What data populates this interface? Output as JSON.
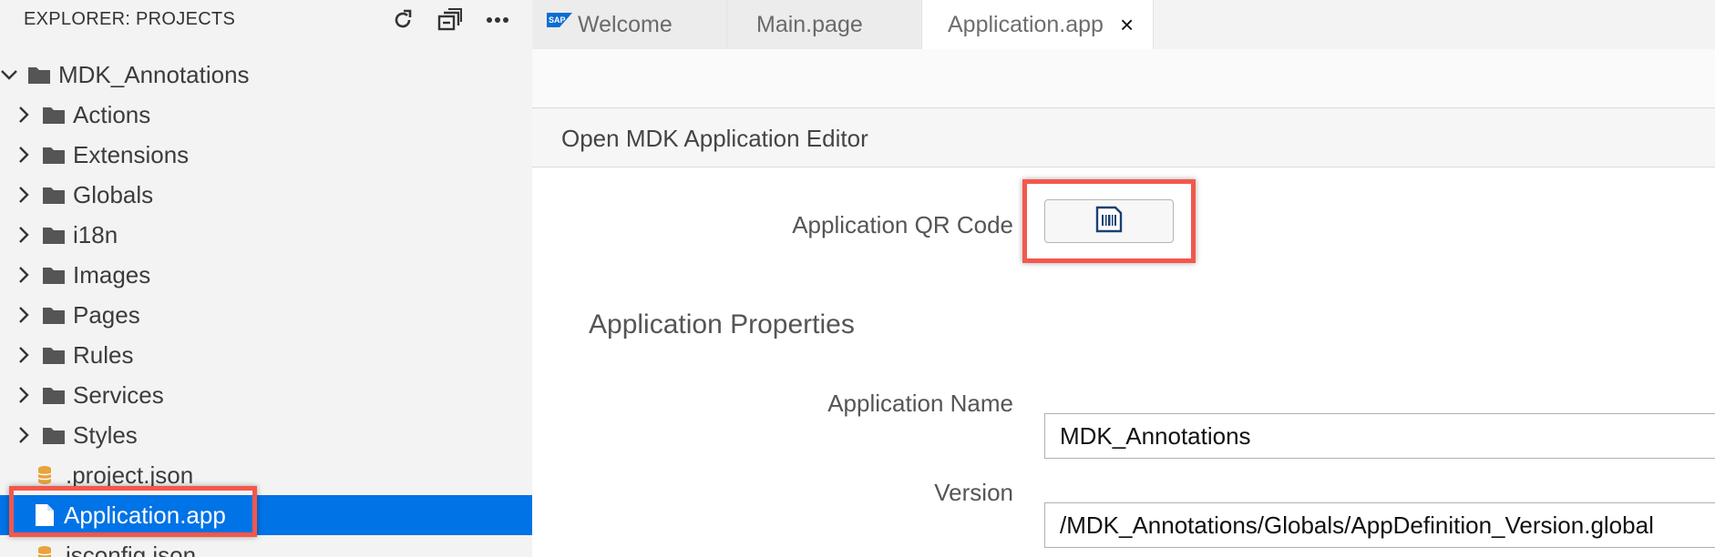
{
  "sidebar": {
    "title": "EXPLORER: PROJECTS",
    "root": {
      "label": "MDK_Annotations",
      "expanded": true
    },
    "folders": [
      {
        "label": "Actions"
      },
      {
        "label": "Extensions"
      },
      {
        "label": "Globals"
      },
      {
        "label": "i18n"
      },
      {
        "label": "Images"
      },
      {
        "label": "Pages"
      },
      {
        "label": "Rules"
      },
      {
        "label": "Services"
      },
      {
        "label": "Styles"
      }
    ],
    "files": [
      {
        "label": ".project.json",
        "icon": "database-icon"
      },
      {
        "label": "Application.app",
        "icon": "file-icon",
        "selected": true
      },
      {
        "label": "jsconfig.json",
        "icon": "database-icon"
      }
    ]
  },
  "tabs": [
    {
      "label": "Welcome",
      "icon": "sap-logo-icon"
    },
    {
      "label": "Main.page"
    },
    {
      "label": "Application.app",
      "active": true,
      "close": "×"
    }
  ],
  "editor": {
    "header": "Open MDK Application Editor",
    "qr_label": "Application QR Code",
    "properties_title": "Application Properties",
    "name_label": "Application Name",
    "name_value": "MDK_Annotations",
    "version_label": "Version",
    "version_value": "/MDK_Annotations/Globals/AppDefinition_Version.global"
  },
  "colors": {
    "accent": "#0073e6",
    "highlight": "#f4574b",
    "folder": "#555555",
    "db_icon": "#e8a33d"
  }
}
